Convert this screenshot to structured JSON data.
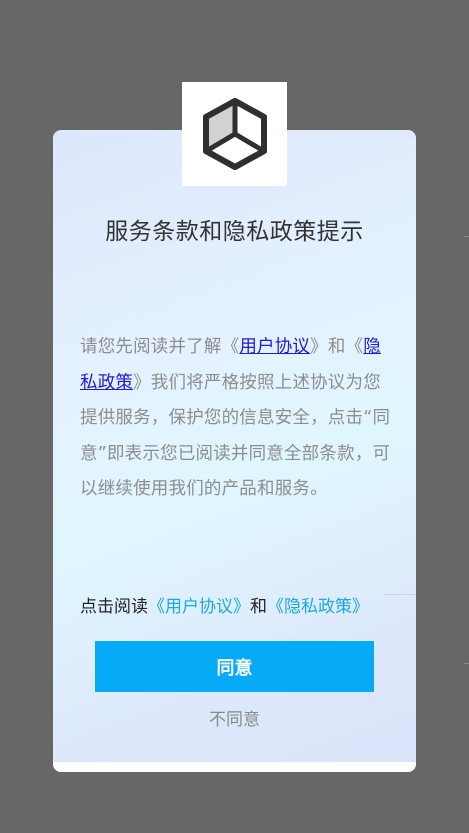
{
  "dialog": {
    "title": "服务条款和隐私政策提示",
    "body": {
      "prefix": "请您先阅读并了解《",
      "user_agreement_link": "用户协议",
      "middle": "》和《",
      "privacy_policy_link": "隐私政策",
      "suffix": "》我们将严格按照上述协议为您提供服务，保护您的信息安全，点击“同意”即表示您已阅读并同意全部条款，可以继续使用我们的产品和服务。"
    },
    "consent": {
      "prefix": "点击阅读",
      "user_agreement": "《用户协议》",
      "and": "和",
      "privacy_policy": "《隐私政策》"
    },
    "agree_label": "同意",
    "disagree_label": "不同意"
  },
  "colors": {
    "overlay": "#676767",
    "accent": "#06aaf7",
    "link_inline": "#2318d8",
    "link_consent": "#1ba8e6"
  },
  "icons": {
    "logo": "cube-icon"
  }
}
